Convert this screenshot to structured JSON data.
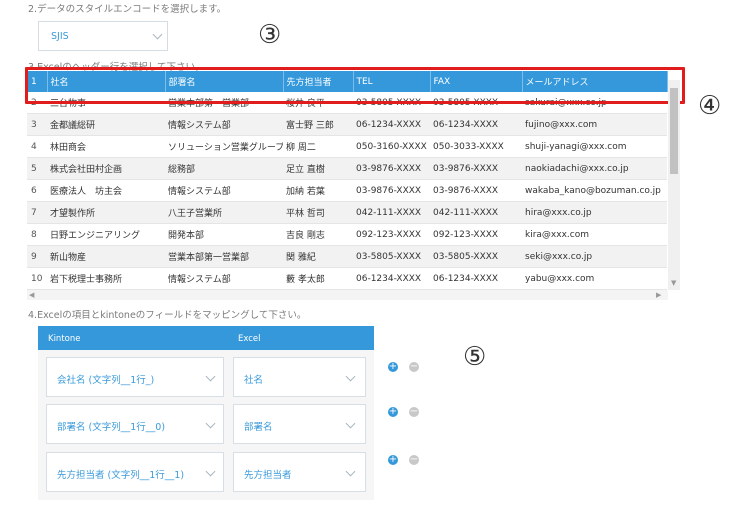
{
  "steps": {
    "step2": "2.データのスタイルエンコードを選択します。",
    "step3": "3.Excelのヘッダー行を選択して下さい。",
    "step4": "4.Excelの項目とkintoneのフィールドをマッピングして下さい。"
  },
  "encoding": {
    "selected": "SJIS"
  },
  "annotations": [
    "③",
    "④",
    "⑤"
  ],
  "table": {
    "rows": [
      [
        "1",
        "社名",
        "部署名",
        "先方担当者",
        "TEL",
        "FAX",
        "メールアドレス"
      ],
      [
        "2",
        "三台物事",
        "営業本部第一営業部",
        "桜井 良平",
        "03-5805-XXXX",
        "03-5805-XXXX",
        "sakurai@xxx.co.jp"
      ],
      [
        "3",
        "金都議総研",
        "情報システム部",
        "富士野 三郎",
        "06-1234-XXXX",
        "06-1234-XXXX",
        "fujino@xxx.com"
      ],
      [
        "4",
        "林田商会",
        "ソリューション営業グループ",
        "柳 周二",
        "050-3160-XXXX",
        "050-3033-XXXX",
        "shuji-yanagi@xxx.com"
      ],
      [
        "5",
        "株式会社田村企画",
        "総務部",
        "足立 直樹",
        "03-9876-XXXX",
        "03-9876-XXXX",
        "naokiadachi@xxx.co.jp"
      ],
      [
        "6",
        "医療法人　坊主会",
        "情報システム部",
        "加納 若葉",
        "03-9876-XXXX",
        "03-9876-XXXX",
        "wakaba_kano@bozuman.co.jp"
      ],
      [
        "7",
        "才望製作所",
        "八王子営業所",
        "平林 哲司",
        "042-111-XXXX",
        "042-111-XXXX",
        "hira@xxx.co.jp"
      ],
      [
        "8",
        "日野エンジニアリング",
        "開発本部",
        "吉良 剛志",
        "092-123-XXXX",
        "092-123-XXXX",
        "kira@xxx.com"
      ],
      [
        "9",
        "新山物産",
        "営業本部第一営業部",
        "関 雅紀",
        "03-5805-XXXX",
        "03-5805-XXXX",
        "seki@xxx.co.jp"
      ],
      [
        "10",
        "岩下税理士事務所",
        "情報システム部",
        "藪 孝太郎",
        "06-1234-XXXX",
        "06-1234-XXXX",
        "yabu@xxx.com"
      ]
    ]
  },
  "mapping": {
    "header_kintone": "Kintone",
    "header_excel": "Excel",
    "rows": [
      {
        "kintone": "会社名 (文字列__1行_)",
        "excel": "社名"
      },
      {
        "kintone": "部署名 (文字列__1行__0)",
        "excel": "部署名"
      },
      {
        "kintone": "先方担当者 (文字列__1行__1)",
        "excel": "先方担当者"
      }
    ],
    "add_label": "+",
    "remove_label": "−"
  }
}
